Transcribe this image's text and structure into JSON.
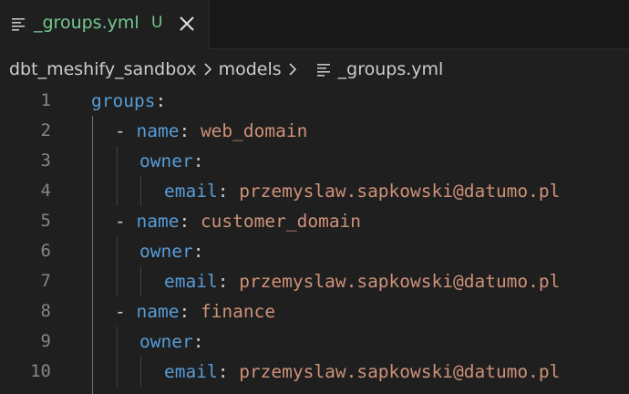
{
  "tab": {
    "filename": "_groups.yml",
    "badge": "U",
    "icon": "lines-file-icon",
    "close_icon": "close-icon"
  },
  "breadcrumb": {
    "items": [
      "dbt_meshify_sandbox",
      "models",
      "_groups.yml"
    ]
  },
  "editor": {
    "line_numbers": [
      "1",
      "2",
      "3",
      "4",
      "5",
      "6",
      "7",
      "8",
      "9",
      "10"
    ],
    "lines": [
      {
        "prefix": "",
        "key": "groups",
        "colon": ":",
        "value": ""
      },
      {
        "prefix": "- ",
        "key": "name",
        "colon": ": ",
        "value": "web_domain"
      },
      {
        "prefix": "",
        "key": "owner",
        "colon": ":",
        "value": ""
      },
      {
        "prefix": "",
        "key": "email",
        "colon": ": ",
        "value": "przemyslaw.sapkowski@datumo.pl"
      },
      {
        "prefix": "- ",
        "key": "name",
        "colon": ": ",
        "value": "customer_domain"
      },
      {
        "prefix": "",
        "key": "owner",
        "colon": ":",
        "value": ""
      },
      {
        "prefix": "",
        "key": "email",
        "colon": ": ",
        "value": "przemyslaw.sapkowski@datumo.pl"
      },
      {
        "prefix": "- ",
        "key": "name",
        "colon": ": ",
        "value": "finance"
      },
      {
        "prefix": "",
        "key": "owner",
        "colon": ":",
        "value": ""
      },
      {
        "prefix": "",
        "key": "email",
        "colon": ": ",
        "value": "przemyslaw.sapkowski@datumo.pl"
      }
    ]
  },
  "colors": {
    "key": "#569cd6",
    "string": "#ce9178",
    "untracked": "#73c991",
    "line_number": "#858585"
  }
}
